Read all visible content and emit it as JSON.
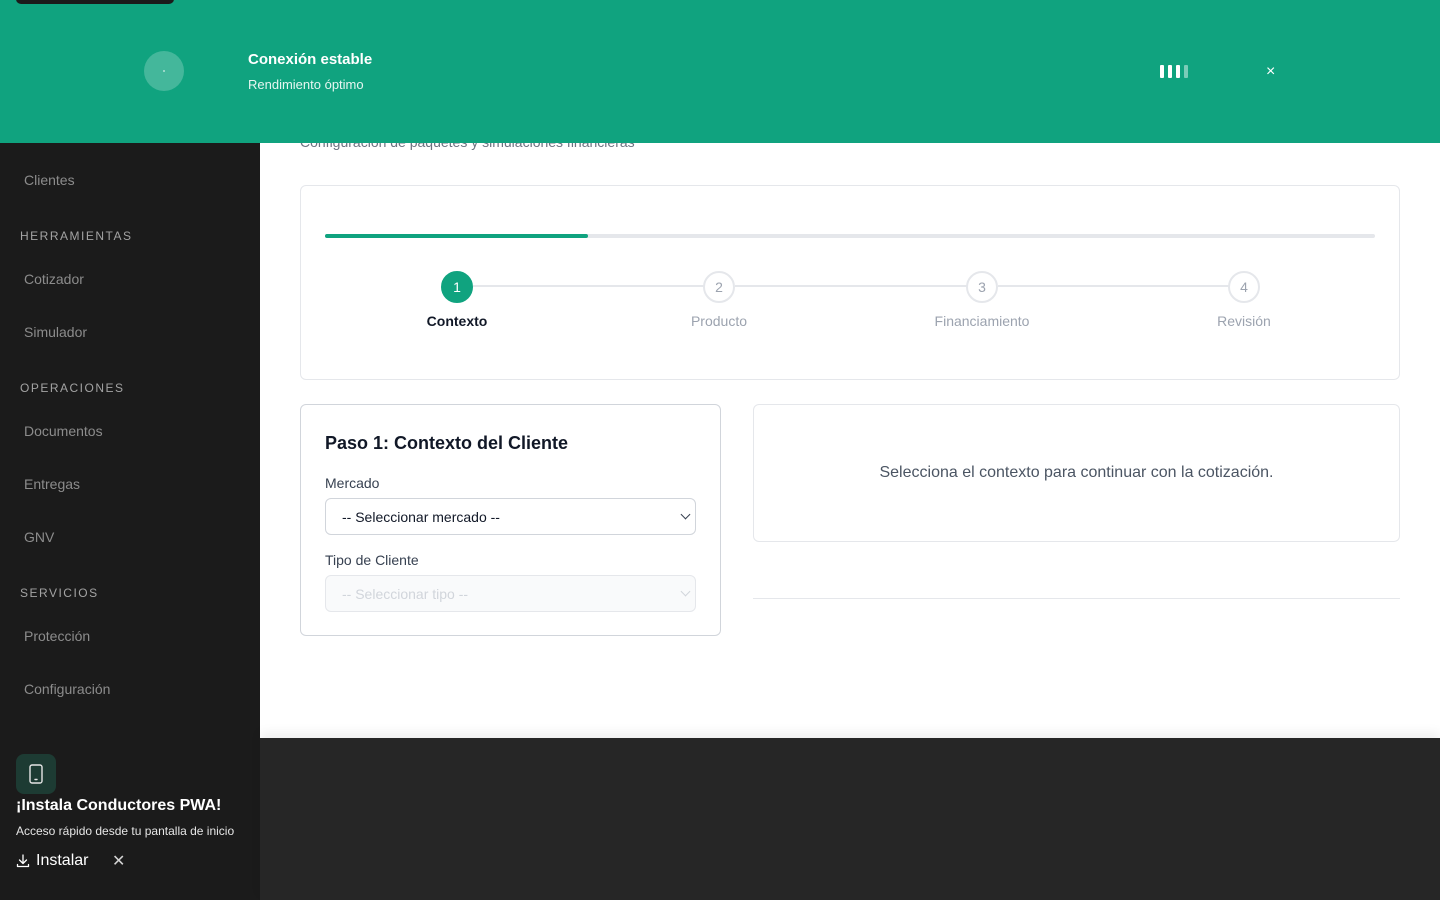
{
  "banner": {
    "title": "Conexión estable",
    "subtitle": "Rendimiento óptimo",
    "close_label": "×",
    "icon": "connection-status-icon",
    "signal_icon": "signal-strength-icon",
    "color": "#10a37f"
  },
  "sidebar": {
    "items": [
      {
        "type": "item",
        "label": "Clientes"
      },
      {
        "type": "section",
        "label": "HERRAMIENTAS"
      },
      {
        "type": "item",
        "label": "Cotizador"
      },
      {
        "type": "item",
        "label": "Simulador"
      },
      {
        "type": "section",
        "label": "OPERACIONES"
      },
      {
        "type": "item",
        "label": "Documentos"
      },
      {
        "type": "item",
        "label": "Entregas"
      },
      {
        "type": "item",
        "label": "GNV"
      },
      {
        "type": "section",
        "label": "SERVICIOS"
      },
      {
        "type": "item",
        "label": "Protección"
      },
      {
        "type": "item",
        "label": "Configuración"
      }
    ]
  },
  "page": {
    "subtitle": "Configuración de paquetes y simulaciones financieras"
  },
  "stepper": {
    "progress": 0.25,
    "steps": [
      {
        "number": "1",
        "label": "Contexto",
        "active": true
      },
      {
        "number": "2",
        "label": "Producto",
        "active": false
      },
      {
        "number": "3",
        "label": "Financiamiento",
        "active": false
      },
      {
        "number": "4",
        "label": "Revisión",
        "active": false
      }
    ]
  },
  "form": {
    "title": "Paso 1: Contexto del Cliente",
    "market_label": "Mercado",
    "market_value": "-- Seleccionar mercado --",
    "client_type_label": "Tipo de Cliente",
    "client_type_value": "-- Seleccionar tipo --"
  },
  "info": {
    "message": "Selecciona el contexto para continuar con la cotización."
  },
  "pwa": {
    "title": "¡Instala Conductores PWA!",
    "subtitle": "Acceso rápido desde tu pantalla de inicio",
    "install_label": "Instalar",
    "close_label": "✕",
    "icon": "mobile-phone-icon"
  }
}
